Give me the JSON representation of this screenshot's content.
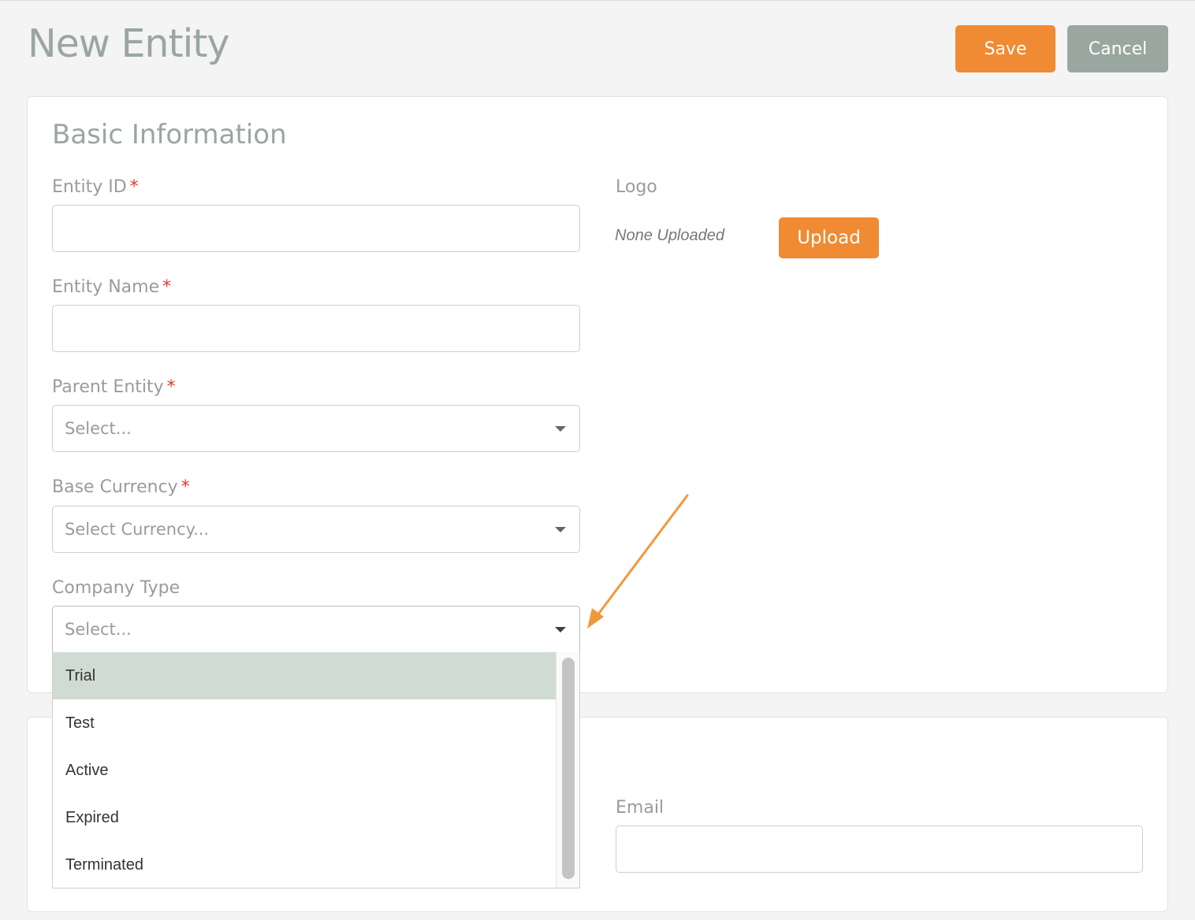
{
  "header": {
    "title": "New Entity",
    "save_label": "Save",
    "cancel_label": "Cancel"
  },
  "basic_info": {
    "title": "Basic Information",
    "entity_id": {
      "label": "Entity ID",
      "required_mark": "*",
      "value": ""
    },
    "entity_name": {
      "label": "Entity Name",
      "required_mark": "*",
      "value": ""
    },
    "parent_entity": {
      "label": "Parent Entity",
      "required_mark": "*",
      "placeholder": "Select..."
    },
    "base_currency": {
      "label": "Base Currency",
      "required_mark": "*",
      "placeholder": "Select Currency..."
    },
    "company_type": {
      "label": "Company Type",
      "placeholder": "Select...",
      "options": [
        "Trial",
        "Test",
        "Active",
        "Expired",
        "Terminated"
      ],
      "highlighted_option": "Trial"
    },
    "logo": {
      "label": "Logo",
      "status": "None Uploaded",
      "upload_label": "Upload"
    }
  },
  "contact": {
    "email": {
      "label": "Email",
      "value": ""
    }
  },
  "colors": {
    "accent": "#f08a33",
    "muted": "#9aa7a0",
    "required": "#e03a2e",
    "highlight": "#d0dbd4",
    "annotation_arrow": "#f0993a"
  },
  "icons": {
    "select_caret": "chevron-down-icon",
    "annotation": "arrow-icon"
  }
}
